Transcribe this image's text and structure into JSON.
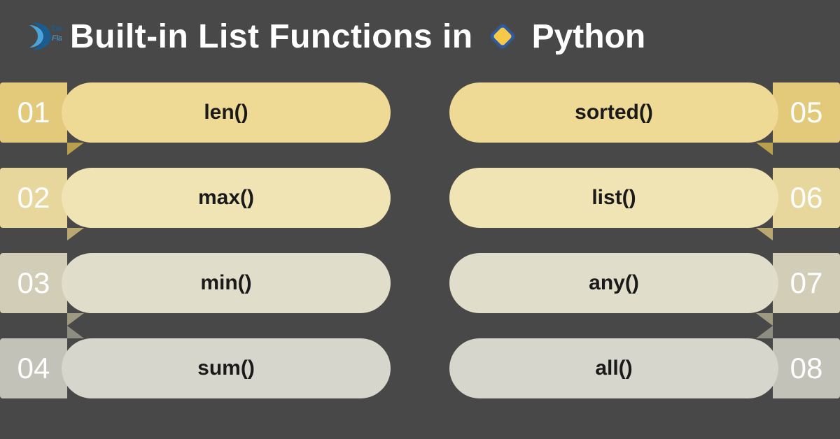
{
  "header": {
    "brand_top": "Data",
    "brand_bottom": "Flair",
    "title_part1": "Built-in List Functions in",
    "title_part2": "Python"
  },
  "items": {
    "left": [
      {
        "num": "01",
        "label": "len()"
      },
      {
        "num": "02",
        "label": "max()"
      },
      {
        "num": "03",
        "label": "min()"
      },
      {
        "num": "04",
        "label": "sum()"
      }
    ],
    "right": [
      {
        "num": "05",
        "label": "sorted()"
      },
      {
        "num": "06",
        "label": "list()"
      },
      {
        "num": "07",
        "label": "any()"
      },
      {
        "num": "08",
        "label": "all()"
      }
    ]
  },
  "colors": {
    "bg": "#484848",
    "rows": [
      "#eeda94",
      "#f0e4b5",
      "#e0ddcb",
      "#d7d6cd"
    ]
  }
}
